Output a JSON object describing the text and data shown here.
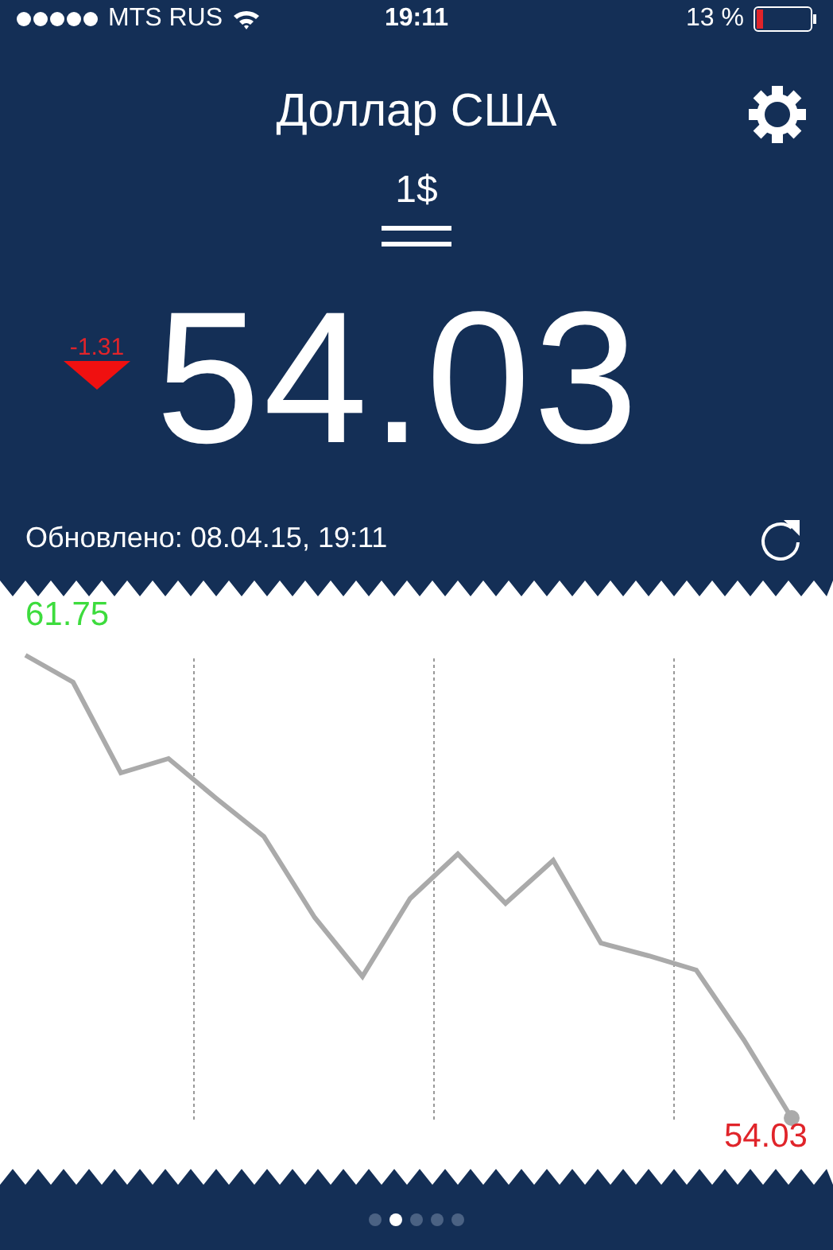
{
  "status_bar": {
    "carrier": "MTS RUS",
    "time": "19:11",
    "battery": "13 %"
  },
  "header": {
    "title": "Доллар США"
  },
  "amount": "1$",
  "rate": {
    "value": "54.03",
    "change": "-1.31",
    "falling": true
  },
  "updated": "Обновлено: 08.04.15, 19:11",
  "chart": {
    "max_label": "61.75",
    "last_label": "54.03"
  },
  "page_indicator": [
    {
      "selected": false
    },
    {
      "selected": true
    },
    {
      "selected": false
    },
    {
      "selected": false
    },
    {
      "selected": false
    }
  ]
}
